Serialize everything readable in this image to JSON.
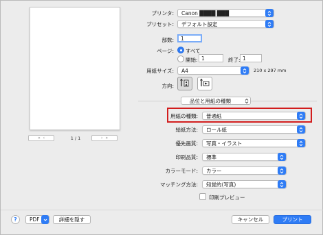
{
  "printer": {
    "label": "プリンタ:",
    "value": "Canon ████ ███"
  },
  "presets": {
    "label": "プリセット:",
    "value": "デフォルト設定"
  },
  "copies": {
    "label": "部数:",
    "value": "1"
  },
  "pages": {
    "label": "ページ:",
    "all_label": "すべて",
    "from_label": "開始:",
    "from_value": "1",
    "to_label": "終了:",
    "to_value": "1"
  },
  "paper_size": {
    "label": "用紙サイズ:",
    "value": "A4",
    "dimensions": "210 x 297 mm"
  },
  "orientation": {
    "label": "方向:"
  },
  "section": {
    "value": "品位と用紙の種類"
  },
  "settings": [
    {
      "label": "用紙の種類:",
      "value": "普通紙"
    },
    {
      "label": "給紙方法:",
      "value": "ロール紙"
    },
    {
      "label": "優先画質:",
      "value": "写真・イラスト"
    },
    {
      "label": "印刷品質:",
      "value": "標準"
    },
    {
      "label": "カラーモード:",
      "value": "カラー"
    },
    {
      "label": "マッチング方法:",
      "value": "知覚的(写真)"
    }
  ],
  "print_preview": {
    "label": "印刷プレビュー"
  },
  "preview": {
    "page_counter": "1 / 1"
  },
  "bottom": {
    "help": "?",
    "pdf": "PDF",
    "hide_details": "詳細を隠す",
    "cancel": "キャンセル",
    "print": "プリント"
  },
  "colors": {
    "accent": "#2f7cf5",
    "highlight": "#d21d1d"
  },
  "icons": [
    "chevron-updown-icon",
    "portrait-orientation-icon",
    "landscape-orientation-icon",
    "first-page-icon",
    "prev-page-icon",
    "next-page-icon",
    "last-page-icon"
  ]
}
